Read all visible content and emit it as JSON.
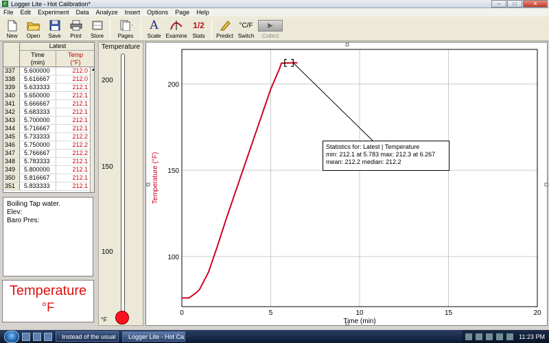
{
  "window": {
    "title": "Logger Lite - Hot Calibration*"
  },
  "menu": [
    "File",
    "Edit",
    "Experiment",
    "Data",
    "Analyze",
    "Insert",
    "Options",
    "Page",
    "Help"
  ],
  "toolbar": {
    "new": "New",
    "open": "Open",
    "save": "Save",
    "print": "Print",
    "store": "Store",
    "pages": "Pages",
    "scale": "Scale",
    "examine": "Examine",
    "stats": "Stats",
    "predict": "Predict",
    "switch": "Switch",
    "collect": "Collect"
  },
  "table": {
    "dataset": "Latest",
    "col_time": "Time\n(min)",
    "col_temp": "Temp\n(°F)",
    "rows": [
      [
        "337",
        "5.600000",
        "212.0"
      ],
      [
        "338",
        "5.616667",
        "212.0"
      ],
      [
        "339",
        "5.633333",
        "212.1"
      ],
      [
        "340",
        "5.650000",
        "212.1"
      ],
      [
        "341",
        "5.666667",
        "212.1"
      ],
      [
        "342",
        "5.683333",
        "212.1"
      ],
      [
        "343",
        "5.700000",
        "212.1"
      ],
      [
        "344",
        "5.716667",
        "212.1"
      ],
      [
        "345",
        "5.733333",
        "212.2"
      ],
      [
        "346",
        "5.750000",
        "212.2"
      ],
      [
        "347",
        "5.766667",
        "212.2"
      ],
      [
        "348",
        "5.783333",
        "212.1"
      ],
      [
        "349",
        "5.800000",
        "212.1"
      ],
      [
        "350",
        "5.816667",
        "212.1"
      ],
      [
        "351",
        "5.833333",
        "212.1"
      ]
    ]
  },
  "notes": {
    "line1": "Boiling Tap water.",
    "line2": "Elev:",
    "line3": "Baro Pres:"
  },
  "meter": {
    "name": "Temperature",
    "unit": "°F"
  },
  "thermometer": {
    "title": "Temperature",
    "unit": "°F",
    "ticks": [
      "200",
      "150",
      "100"
    ]
  },
  "stats": {
    "line1": "Statistics for: Latest | Temperature",
    "line2": "min: 212.1 at 5.783 max: 212.3 at 6.267",
    "line3": "mean: 212.2 median: 212.2"
  },
  "chart_data": {
    "type": "line",
    "xlabel": "Time (min)",
    "ylabel": "Temperature (°F)",
    "xlim": [
      0,
      20
    ],
    "ylim": [
      71,
      220
    ],
    "xticks": [
      0,
      5,
      10,
      15,
      20
    ],
    "yticks": [
      100,
      150,
      200
    ],
    "grid": true,
    "series": [
      {
        "color": "#cc0022",
        "x": [
          0,
          0.4,
          0.8,
          1.0,
          1.5,
          2.0,
          2.5,
          3.0,
          3.5,
          4.0,
          4.5,
          5.0,
          5.5,
          5.6,
          5.8,
          6.0,
          6.267,
          6.5
        ],
        "y": [
          76,
          76,
          79,
          81,
          91,
          106,
          122,
          137,
          152,
          167,
          182,
          197,
          209,
          212,
          212.1,
          212.1,
          212.3,
          212.2
        ]
      }
    ],
    "selection_range": [
      5.783,
      6.267
    ]
  },
  "taskbar": {
    "item1": "Instead of the usual ...",
    "item2": "Logger Lite - Hot Ca...",
    "clock": "11:23 PM"
  }
}
